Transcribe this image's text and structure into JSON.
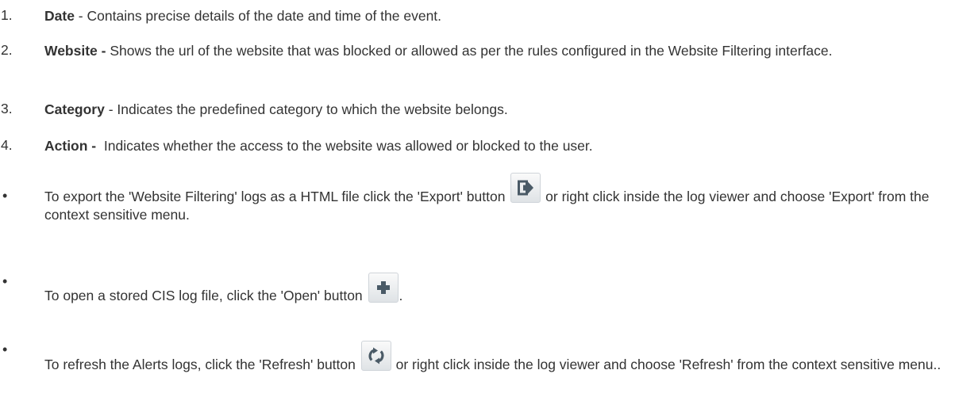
{
  "list": [
    {
      "num": "1.",
      "term": "Date",
      "sep": " - ",
      "desc": "Contains precise details of the date and time of the event."
    },
    {
      "num": "2.",
      "term": "Website -",
      "sep": " ",
      "desc": "Shows the url of the website that was blocked or allowed as per the rules configured in the Website Filtering interface."
    },
    {
      "num": "3.",
      "term": "Category",
      "sep": " - ",
      "desc": "Indicates the predefined category to which the website belongs."
    },
    {
      "num": "4.",
      "term": "Action -",
      "sep": "  ",
      "desc": "Indicates whether the access to the website was allowed or blocked to the user."
    }
  ],
  "bullets": {
    "symbol": "•",
    "export": {
      "before": "To export the 'Website Filtering' logs as a HTML file click the 'Export' button ",
      "after": " or right click inside the log viewer and choose 'Export' from the context sensitive menu.",
      "icon": "export-icon"
    },
    "open": {
      "before": "To open a stored CIS log file, click the 'Open' button ",
      "after": ".",
      "icon": "plus-icon"
    },
    "refresh": {
      "before": "To refresh the Alerts logs, click the 'Refresh' button ",
      "after": " or right click inside the log viewer and choose 'Refresh' from the context sensitive menu..",
      "icon": "refresh-icon"
    }
  },
  "colors": {
    "text": "#333333",
    "icon": "#4a5a66"
  }
}
